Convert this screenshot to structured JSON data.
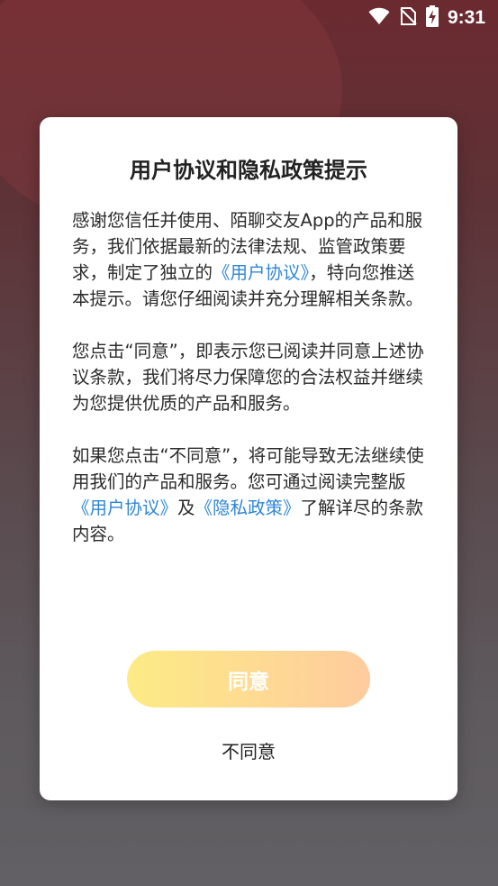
{
  "status_bar": {
    "time": "9:31",
    "icons": [
      "wifi-icon",
      "no-signal-icon",
      "battery-charging-icon"
    ]
  },
  "dialog": {
    "title": "用户协议和隐私政策提示",
    "paragraph1": {
      "before_link": "感谢您信任并使用、陌聊交友App的产品和服务，我们依据最新的法律法规、监管政策要求，制定了独立的",
      "link_user_agreement": "《用户协议》",
      "after_link": "，特向您推送本提示。请您仔细阅读并充分理解相关条款。"
    },
    "paragraph2": "您点击“同意”，即表示您已阅读并同意上述协议条款，我们将尽力保障您的合法权益并继续为您提供优质的产品和服务。",
    "paragraph3": {
      "before_link": "如果您点击“不同意”，将可能导致无法继续使用我们的产品和服务。您可通过阅读完整版",
      "link_user_agreement": "《用户协议》",
      "and": "及",
      "link_privacy_policy": "《隐私政策》",
      "after_link": "了解详尽的条款内容。"
    },
    "agree_label": "同意",
    "disagree_label": "不同意"
  },
  "colors": {
    "link": "#2f86d6",
    "agree_gradient_start": "#fdeb85",
    "agree_gradient_end": "#fecb9e",
    "background_top": "#6b2a30",
    "background_bottom": "#626064"
  }
}
